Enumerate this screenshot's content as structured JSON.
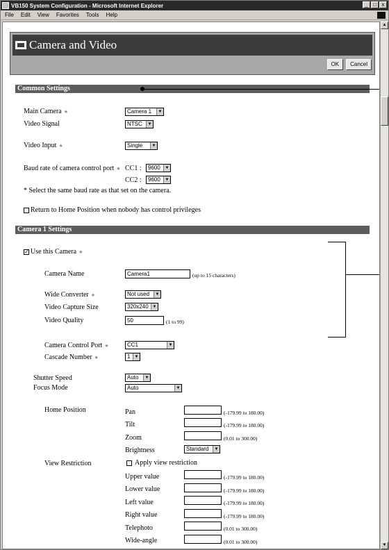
{
  "window": {
    "title": "VB150 System Configuration - Microsoft Internet Explorer",
    "controls": [
      "_",
      "□",
      "x"
    ]
  },
  "menu": [
    "File",
    "Edit",
    "View",
    "Favorites",
    "Tools",
    "Help"
  ],
  "panel": {
    "title": "Camera and Video",
    "ok_label": "OK",
    "cancel_label": "Cancel"
  },
  "common": {
    "header": "Common Settings",
    "main_camera": {
      "label": "Main Camera",
      "value": "Camera 1"
    },
    "video_signal": {
      "label": "Video Signal",
      "value": "NTSC"
    },
    "video_input": {
      "label": "Video Input",
      "value": "Single"
    },
    "baud": {
      "label": "Baud rate of camera control port",
      "cc1_label": "CC1 :",
      "cc1_value": "9600",
      "cc2_label": "CC2 :",
      "cc2_value": "9600",
      "note": "* Select the same baud rate as that set on the camera."
    },
    "return_home": {
      "label": "Return to Home Position when nobody has control privileges",
      "checked": false
    }
  },
  "camera1": {
    "header": "Camera 1 Settings",
    "use_camera": {
      "label": "Use this Camera",
      "checked": true
    },
    "name": {
      "label": "Camera Name",
      "value": "Camera1",
      "hint": "(up to 15 characters)"
    },
    "wide_converter": {
      "label": "Wide Converter",
      "value": "Not used"
    },
    "capture_size": {
      "label": "Video Capture Size",
      "value": "320x240"
    },
    "quality": {
      "label": "Video Quality",
      "value": "50",
      "hint": "(1 to 99)"
    },
    "control_port": {
      "label": "Camera Control Port",
      "value": "CC1"
    },
    "cascade": {
      "label": "Cascade Number",
      "value": "1"
    },
    "shutter": {
      "label": "Shutter Speed",
      "value": "Auto"
    },
    "focus": {
      "label": "Focus Mode",
      "value": "Auto"
    },
    "home": {
      "label": "Home Position",
      "pan": {
        "label": "Pan",
        "hint": "(-179.99 to 180.00)"
      },
      "tilt": {
        "label": "Tilt",
        "hint": "(-179.99 to 180.00)"
      },
      "zoom": {
        "label": "Zoom",
        "hint": "(0.01 to 300.00)"
      },
      "brightness": {
        "label": "Brightness",
        "value": "Standard"
      }
    },
    "restriction": {
      "label": "View Restriction",
      "apply": {
        "label": "Apply view restriction",
        "checked": false
      },
      "upper": {
        "label": "Upper value",
        "hint": "(-179.99 to 180.00)"
      },
      "lower": {
        "label": "Lower value",
        "hint": "(-179.99 to 180.00)"
      },
      "left": {
        "label": "Left value",
        "hint": "(-179.99 to 180.00)"
      },
      "right": {
        "label": "Right value",
        "hint": "(-179.99 to 180.00)"
      },
      "tele": {
        "label": "Telephoto",
        "hint": "(0.01 to 300.00)"
      },
      "wide": {
        "label": "Wide-angle",
        "hint": "(0.01 to 300.00)"
      }
    }
  },
  "icons": {
    "marker": "★",
    "caret": "▼",
    "check": "✓",
    "scroll_up": "▲",
    "scroll_down": "▼"
  }
}
